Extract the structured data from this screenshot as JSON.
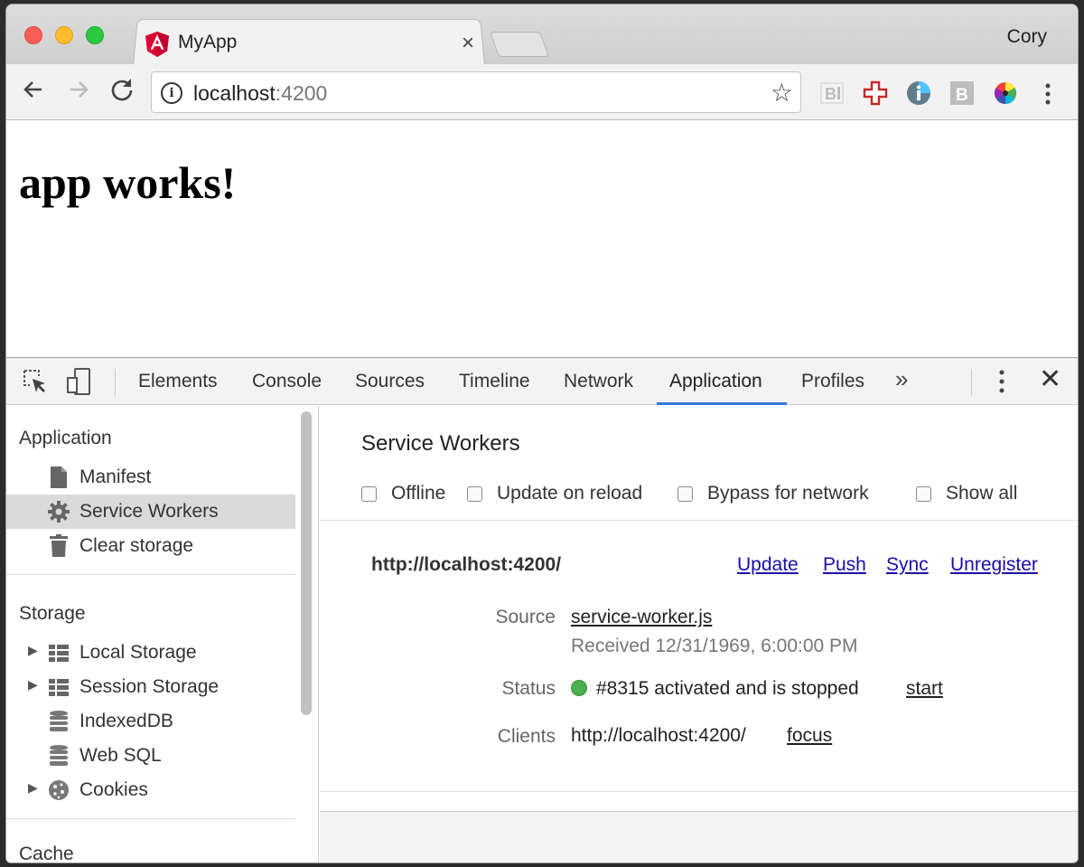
{
  "browser": {
    "tab_title": "MyApp",
    "tab_close": "×",
    "profile_name": "Cory",
    "url_host": "localhost",
    "url_port": ":4200"
  },
  "page": {
    "heading": "app works!"
  },
  "devtools": {
    "tabs": [
      "Elements",
      "Console",
      "Sources",
      "Timeline",
      "Network",
      "Application",
      "Profiles"
    ],
    "active_tab": "Application",
    "more_label": "»",
    "close_label": "✕",
    "accent_color": "#3879d9",
    "sidebar": {
      "section_application": "Application",
      "application_items": [
        "Manifest",
        "Service Workers",
        "Clear storage"
      ],
      "selected_item": "Service Workers",
      "section_storage": "Storage",
      "storage_items": [
        "Local Storage",
        "Session Storage",
        "IndexedDB",
        "Web SQL",
        "Cookies"
      ],
      "section_cache": "Cache"
    },
    "service_workers": {
      "title": "Service Workers",
      "options": [
        "Offline",
        "Update on reload",
        "Bypass for network",
        "Show all"
      ],
      "origin": "http://localhost:4200/",
      "actions": [
        "Update",
        "Push",
        "Sync",
        "Unregister"
      ],
      "source_label": "Source",
      "source_file": "service-worker.js",
      "received": "Received 12/31/1969, 6:00:00 PM",
      "status_label": "Status",
      "status_text": "#8315 activated and is stopped",
      "status_color": "#4caf50",
      "status_action": "start",
      "clients_label": "Clients",
      "clients_value": "http://localhost:4200/",
      "clients_action": "focus"
    }
  }
}
